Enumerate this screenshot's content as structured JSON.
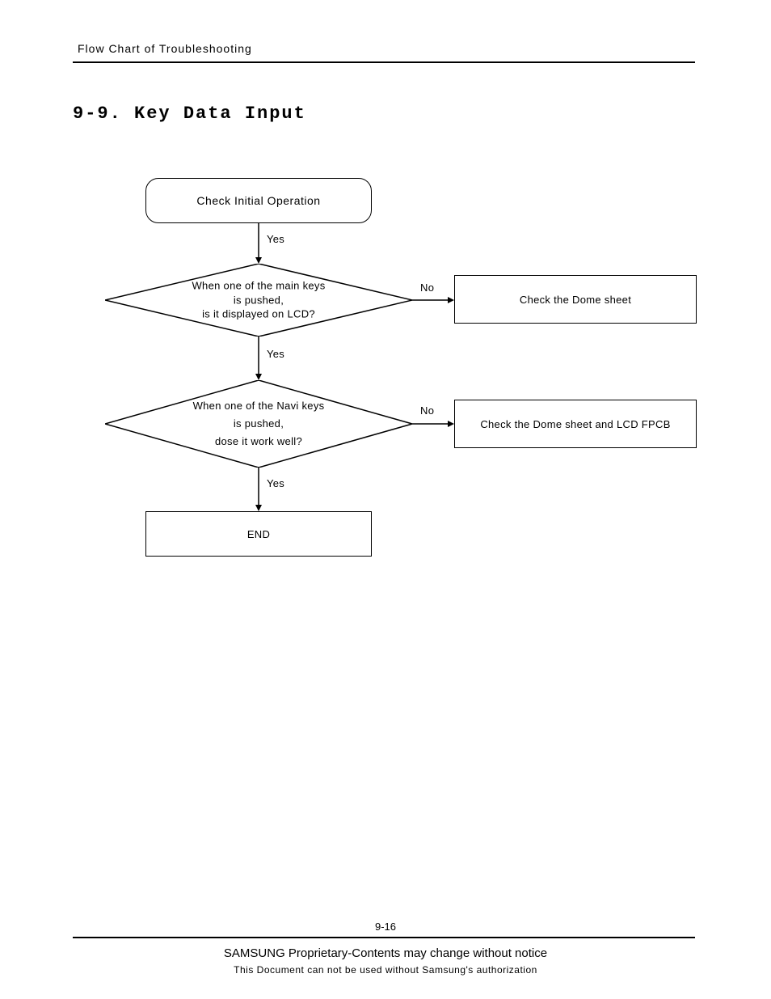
{
  "header": {
    "chapter": "Flow Chart of Troubleshooting"
  },
  "section": {
    "title": "9-9. Key Data Input"
  },
  "flow": {
    "start": "Check Initial Operation",
    "decision1": "When one of the main keys\nis pushed,\nis it displayed on LCD?",
    "decision2": "When one of the Navi keys\nis pushed,\ndose it work well?",
    "action1": "Check the Dome sheet",
    "action2": "Check the Dome sheet and LCD FPCB",
    "end": "END",
    "yes": "Yes",
    "no": "No"
  },
  "footer": {
    "page": "9-16",
    "line1": "SAMSUNG Proprietary-Contents may change without notice",
    "line2": "This Document can not be used without Samsung's authorization"
  }
}
